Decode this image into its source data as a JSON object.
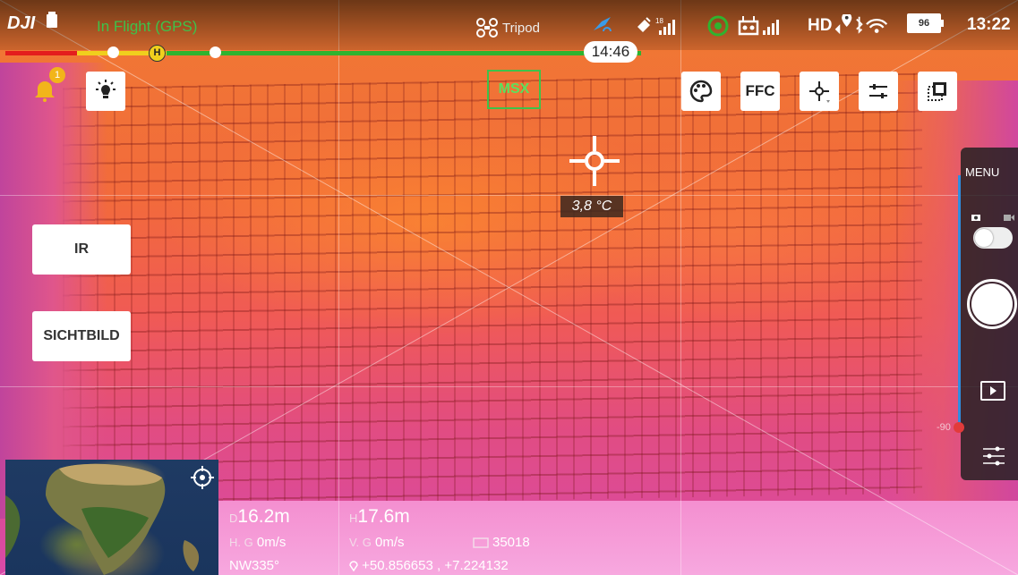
{
  "status_bar": {
    "app_logo": "DJI",
    "flight_status": "In Flight (GPS)",
    "mode": "Tripod",
    "video_link": "HD",
    "satellites": "18",
    "battery_percent": "96",
    "clock": "13:22"
  },
  "flight_progress": {
    "home_marker": "H",
    "remaining_time": "14:46"
  },
  "toolbar": {
    "alert_count": "1",
    "msx_label": "MSX",
    "ffc_label": "FFC"
  },
  "thermal": {
    "spot_temperature": "3,8 °C"
  },
  "view_modes": {
    "ir_label": "IR",
    "visual_label": "SICHTBILD"
  },
  "camera_panel": {
    "menu_label": "MENU",
    "gimbal_angle": "-90"
  },
  "telemetry": {
    "distance_prefix": "D",
    "distance": "16.2m",
    "height_prefix": "H",
    "height": "17.6m",
    "h_speed_prefix": "H. G",
    "h_speed": "0m/s",
    "v_speed_prefix": "V. G",
    "v_speed": "0m/s",
    "photo_count": "35018",
    "heading": "NW335°",
    "coordinates": "+50.856653 , +7.224132"
  },
  "colors": {
    "accent_green": "#3ec24a",
    "warn_yellow": "#f0cf1d",
    "danger_red": "#e41d1d",
    "gimbal_blue": "#2f8de0"
  }
}
